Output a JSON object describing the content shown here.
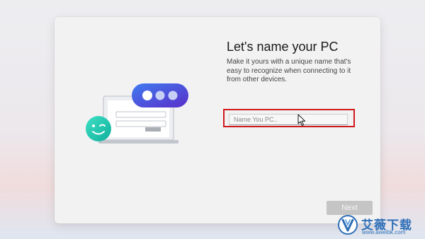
{
  "dialog": {
    "title": "Let's name your PC",
    "description": "Make it yours with a unique name that's easy to recognize when connecting to it from other devices.",
    "name_input": {
      "value": "",
      "placeholder": "Name You PC.."
    },
    "next_label": "Next"
  },
  "illustration": {
    "icons": [
      "laptop-icon",
      "password-dots-icon",
      "winking-face-icon"
    ]
  },
  "watermark": {
    "title": "艾薇下载",
    "url": "www.aweibk.com"
  },
  "colors": {
    "highlight": "#d0181c",
    "accent_blue": "#2f5fe0",
    "accent_teal": "#24c9b8",
    "next_disabled": "#c5c5c5"
  }
}
